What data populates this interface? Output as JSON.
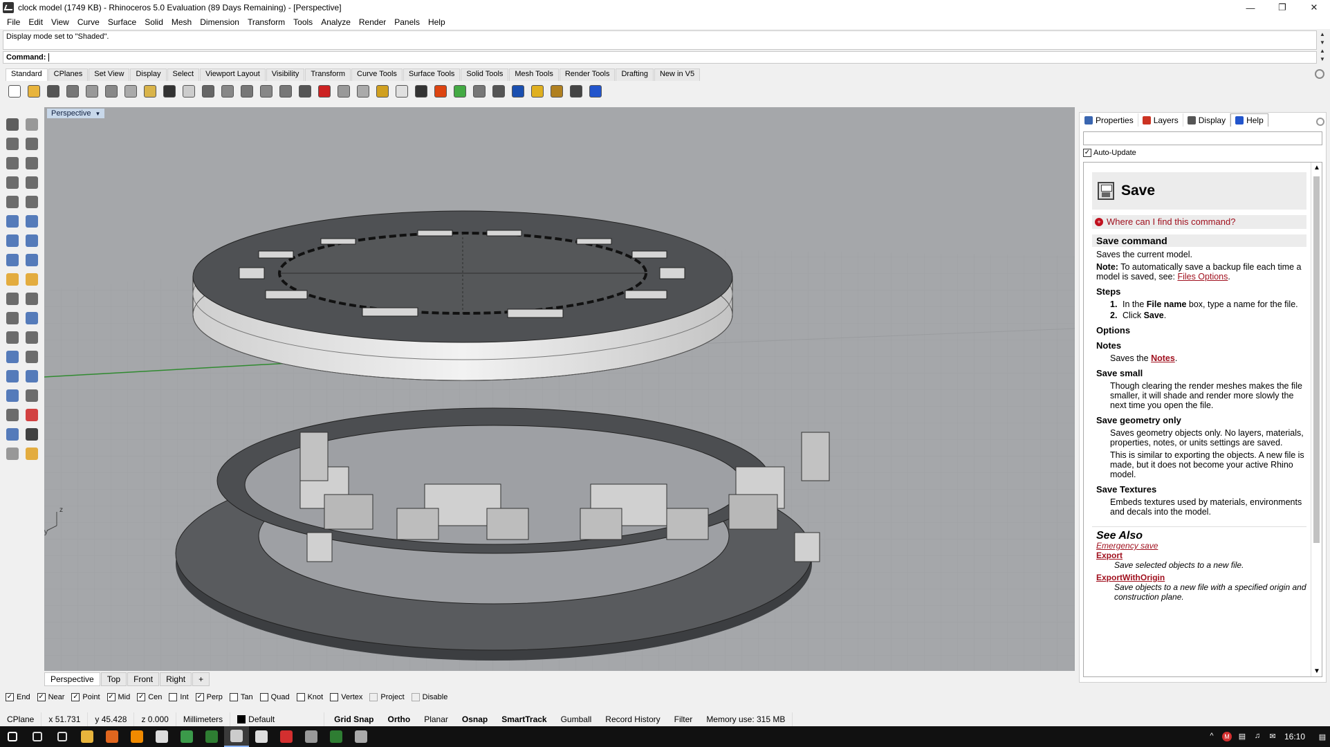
{
  "window": {
    "title": "clock model (1749 KB) - Rhinoceros 5.0 Evaluation (89 Days Remaining) - [Perspective]",
    "controls": [
      "—",
      "❐",
      "✕"
    ]
  },
  "menu": [
    "File",
    "Edit",
    "View",
    "Curve",
    "Surface",
    "Solid",
    "Mesh",
    "Dimension",
    "Transform",
    "Tools",
    "Analyze",
    "Render",
    "Panels",
    "Help"
  ],
  "command": {
    "history": "Display mode set to \"Shaded\".",
    "prompt": "Command:"
  },
  "toolbar_tabs": [
    "Standard",
    "CPlanes",
    "Set View",
    "Display",
    "Select",
    "Viewport Layout",
    "Visibility",
    "Transform",
    "Curve Tools",
    "Surface Tools",
    "Solid Tools",
    "Mesh Tools",
    "Render Tools",
    "Drafting",
    "New in V5"
  ],
  "toolbar_icons": [
    {
      "name": "new-icon",
      "color": "#ffffff"
    },
    {
      "name": "open-icon",
      "color": "#e8b43c"
    },
    {
      "name": "save-icon",
      "color": "#555555"
    },
    {
      "name": "print-icon",
      "color": "#777777"
    },
    {
      "name": "import-icon",
      "color": "#999999"
    },
    {
      "name": "cut-icon",
      "color": "#888888"
    },
    {
      "name": "copy-icon",
      "color": "#aaaaaa"
    },
    {
      "name": "paste-icon",
      "color": "#d9b44a"
    },
    {
      "name": "undo-icon",
      "color": "#333333"
    },
    {
      "name": "pan-icon",
      "color": "#cccccc"
    },
    {
      "name": "rotate-view-icon",
      "color": "#666666"
    },
    {
      "name": "zoom-icon",
      "color": "#888888"
    },
    {
      "name": "zoom-window-icon",
      "color": "#777777"
    },
    {
      "name": "zoom-extents-icon",
      "color": "#888888"
    },
    {
      "name": "zoom-selected-icon",
      "color": "#777777"
    },
    {
      "name": "four-viewports-icon",
      "color": "#555555"
    },
    {
      "name": "car-icon",
      "color": "#cc2222"
    },
    {
      "name": "camera-icon",
      "color": "#999999"
    },
    {
      "name": "cplane-icon",
      "color": "#aaaaaa"
    },
    {
      "name": "points-icon",
      "color": "#d0a020"
    },
    {
      "name": "light-icon",
      "color": "#e0e0e0"
    },
    {
      "name": "lock-icon",
      "color": "#333333"
    },
    {
      "name": "material-icon",
      "color": "#dd4411"
    },
    {
      "name": "color-wheel-icon",
      "color": "#44aa44"
    },
    {
      "name": "shade-icon",
      "color": "#777777"
    },
    {
      "name": "render-sphere-icon",
      "color": "#555555"
    },
    {
      "name": "render-icon",
      "color": "#1a4fb0"
    },
    {
      "name": "filter-icon",
      "color": "#e0b020"
    },
    {
      "name": "options-icon",
      "color": "#b08020"
    },
    {
      "name": "dimension-icon",
      "color": "#444444"
    },
    {
      "name": "help-icon",
      "color": "#2255cc"
    }
  ],
  "left_tools": [
    {
      "name": "select-arrow-icon",
      "color": "#444444"
    },
    {
      "name": "point-icon",
      "color": "#888888"
    },
    {
      "name": "polyline-icon",
      "color": "#555555"
    },
    {
      "name": "curve-icon",
      "color": "#555555"
    },
    {
      "name": "circle-icon",
      "color": "#555555"
    },
    {
      "name": "ellipse-icon",
      "color": "#555555"
    },
    {
      "name": "polygon-icon",
      "color": "#555555"
    },
    {
      "name": "rectangle-icon",
      "color": "#555555"
    },
    {
      "name": "arc-icon",
      "color": "#555555"
    },
    {
      "name": "fillet-curve-icon",
      "color": "#555555"
    },
    {
      "name": "surface-icon",
      "color": "#3a66b0"
    },
    {
      "name": "sweep-icon",
      "color": "#3a66b0"
    },
    {
      "name": "box-icon",
      "color": "#3a66b0"
    },
    {
      "name": "boolean-icon",
      "color": "#3a66b0"
    },
    {
      "name": "extrude-icon",
      "color": "#3a66b0"
    },
    {
      "name": "mesh-icon",
      "color": "#3a66b0"
    },
    {
      "name": "explode-icon",
      "color": "#e0a020"
    },
    {
      "name": "join-icon",
      "color": "#e0a020"
    },
    {
      "name": "trim-icon",
      "color": "#555555"
    },
    {
      "name": "split-icon",
      "color": "#555555"
    },
    {
      "name": "group-icon",
      "color": "#555555"
    },
    {
      "name": "ungroup-icon",
      "color": "#3a66b0"
    },
    {
      "name": "rotate-icon",
      "color": "#555555"
    },
    {
      "name": "scale-icon",
      "color": "#555555"
    },
    {
      "name": "text-icon",
      "color": "#3a66b0"
    },
    {
      "name": "dimension-tool-icon",
      "color": "#555555"
    },
    {
      "name": "block-icon",
      "color": "#3a66b0"
    },
    {
      "name": "insert-icon",
      "color": "#3a66b0"
    },
    {
      "name": "solid-tools-icon",
      "color": "#3a66b0"
    },
    {
      "name": "grid-icon",
      "color": "#555555"
    },
    {
      "name": "array-icon",
      "color": "#555555"
    },
    {
      "name": "distance-icon",
      "color": "#cc2222"
    },
    {
      "name": "analyze-icon",
      "color": "#3a66b0"
    },
    {
      "name": "check-icon",
      "color": "#222222"
    },
    {
      "name": "render-tools-icon",
      "color": "#888888"
    },
    {
      "name": "light-tool-icon",
      "color": "#e0a020"
    }
  ],
  "viewport": {
    "label": "Perspective",
    "axes": {
      "x": "x",
      "y": "y",
      "z": "z"
    }
  },
  "viewport_tabs": [
    "Perspective",
    "Top",
    "Front",
    "Right",
    "+"
  ],
  "panel": {
    "tabs": [
      {
        "label": "Properties",
        "color": "#3a66b0"
      },
      {
        "label": "Layers",
        "color": "#cc3322"
      },
      {
        "label": "Display",
        "color": "#555555"
      },
      {
        "label": "Help",
        "color": "#2255cc"
      }
    ],
    "auto_update": "Auto-Update",
    "help": {
      "title": "Save",
      "where": "Where can I find this command?",
      "command_heading": "Save command",
      "desc": "Saves the current model.",
      "note_label": "Note:",
      "note": "To automatically save a backup file each time a model is saved, see:",
      "note_link": "Files Options",
      "steps_heading": "Steps",
      "steps": [
        {
          "num": "1.",
          "pre": "In the ",
          "bold": "File name",
          "post": " box, type a name for the file."
        },
        {
          "num": "2.",
          "pre": "Click ",
          "bold": "Save",
          "post": "."
        }
      ],
      "options_heading": "Options",
      "notes_heading": "Notes",
      "notes_pre": "Saves the",
      "notes_link": "Notes",
      "save_small_heading": "Save small",
      "save_small": "Though clearing the render meshes makes the file smaller, it will shade and render more slowly the next time you open the file.",
      "save_geom_heading": "Save geometry only",
      "save_geom_1": "Saves geometry objects only. No layers, materials, properties, notes, or units settings are saved.",
      "save_geom_2": "This is similar to exporting the objects. A new file is made, but it does not become your active Rhino model.",
      "save_tex_heading": "Save Textures",
      "save_tex": "Embeds textures used by materials, environments and decals into the model.",
      "see_also": "See Also",
      "emergency": "Emergency save",
      "export": "Export",
      "export_desc": "Save selected objects to a new file.",
      "export_origin": "ExportWithOrigin",
      "export_origin_desc": "Save objects to a new file with a specified origin and construction plane."
    }
  },
  "osnap": [
    {
      "label": "End",
      "checked": true
    },
    {
      "label": "Near",
      "checked": true
    },
    {
      "label": "Point",
      "checked": true
    },
    {
      "label": "Mid",
      "checked": true
    },
    {
      "label": "Cen",
      "checked": true
    },
    {
      "label": "Int",
      "checked": false
    },
    {
      "label": "Perp",
      "checked": true
    },
    {
      "label": "Tan",
      "checked": false
    },
    {
      "label": "Quad",
      "checked": false
    },
    {
      "label": "Knot",
      "checked": false
    },
    {
      "label": "Vertex",
      "checked": false
    },
    {
      "label": "Project",
      "checked": false
    },
    {
      "label": "Disable",
      "checked": false
    }
  ],
  "status": {
    "cplane": "CPlane",
    "x": "x 51.731",
    "y": "y 45.428",
    "z": "z 0.000",
    "units": "Millimeters",
    "layer": "Default",
    "buttons": [
      {
        "label": "Grid Snap",
        "bold": true
      },
      {
        "label": "Ortho",
        "bold": true
      },
      {
        "label": "Planar",
        "bold": false
      },
      {
        "label": "Osnap",
        "bold": true
      },
      {
        "label": "SmartTrack",
        "bold": true
      },
      {
        "label": "Gumball",
        "bold": false
      },
      {
        "label": "Record History",
        "bold": false
      },
      {
        "label": "Filter",
        "bold": false
      }
    ],
    "memory": "Memory use: 315 MB"
  },
  "taskbar": {
    "apps": [
      {
        "name": "start-icon",
        "color": "#ffffff"
      },
      {
        "name": "search-icon",
        "color": "#dddddd"
      },
      {
        "name": "task-view-icon",
        "color": "#dddddd"
      },
      {
        "name": "file-explorer-icon",
        "color": "#e8b43c"
      },
      {
        "name": "firefox-icon",
        "color": "#e0661e"
      },
      {
        "name": "vlc-icon",
        "color": "#f08a00"
      },
      {
        "name": "mail-icon",
        "color": "#dddddd"
      },
      {
        "name": "chrome-icon",
        "color": "#3b9a4a"
      },
      {
        "name": "chrome-alt-icon",
        "color": "#2e7d32"
      },
      {
        "name": "rhino-icon",
        "color": "#cccccc"
      },
      {
        "name": "photos-icon",
        "color": "#dddddd"
      },
      {
        "name": "acrobat-icon",
        "color": "#d32f2f"
      },
      {
        "name": "calculator-icon",
        "color": "#999999"
      },
      {
        "name": "excel-icon",
        "color": "#2e7d32"
      },
      {
        "name": "network-icon",
        "color": "#aaaaaa"
      }
    ],
    "active_index": 9,
    "tray": [
      "^",
      "M",
      "▤",
      "♫",
      "✉"
    ],
    "time": "16:10",
    "notification": "▤"
  }
}
